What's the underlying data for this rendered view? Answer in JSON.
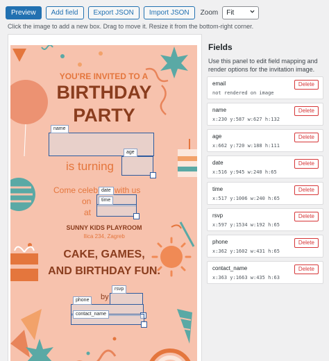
{
  "toolbar": {
    "preview": "Preview",
    "add_field": "Add field",
    "export_json": "Export JSON",
    "import_json": "Import JSON",
    "zoom_label": "Zoom",
    "zoom_value": "Fit"
  },
  "hint": "Click the image to add a new box. Drag to move it. Resize it from the bottom-right corner.",
  "invitation": {
    "line1": "YOU'RE INVITED TO A",
    "line2": "BIRTHDAY",
    "line3": "PARTY",
    "turning": "is turning",
    "come": "Come celeb",
    "with_us": "with us",
    "on": "on",
    "at": "at",
    "venue": "SUNNY KIDS PLAYROOM",
    "address": "Ilica 234, Zagreb",
    "slogan1": "CAKE, GAMES,",
    "slogan2": "AND BIRTHDAY FUN.",
    "rsvp_fragment": "by"
  },
  "overlay_fields": [
    {
      "label": "name"
    },
    {
      "label": "age"
    },
    {
      "label": "date"
    },
    {
      "label": "time"
    },
    {
      "label": "rsvp"
    },
    {
      "label": "phone"
    },
    {
      "label": "contact_name"
    }
  ],
  "panel": {
    "title": "Fields",
    "description": "Use this panel to edit field mapping and render options for the invitation image.",
    "delete_label": "Delete",
    "fields": [
      {
        "name": "email",
        "meta": "not rendered on image"
      },
      {
        "name": "name",
        "meta": "x:230 y:587 w:627 h:132"
      },
      {
        "name": "age",
        "meta": "x:662 y:720 w:188 h:111"
      },
      {
        "name": "date",
        "meta": "x:516 y:945 w:240 h:65"
      },
      {
        "name": "time",
        "meta": "x:517 y:1006 w:240 h:65"
      },
      {
        "name": "rsvp",
        "meta": "x:597 y:1534 w:192 h:65"
      },
      {
        "name": "phone",
        "meta": "x:362 y:1602 w:431 h:65"
      },
      {
        "name": "contact_name",
        "meta": "x:363 y:1663 w:435 h:63"
      }
    ]
  },
  "colors": {
    "accent": "#2271b1",
    "delete": "#d63638",
    "invite_bg": "#f7c2ad",
    "invite_brown": "#8a3d1e",
    "invite_orange": "#e4763d",
    "invite_teal": "#5aa9a5"
  }
}
